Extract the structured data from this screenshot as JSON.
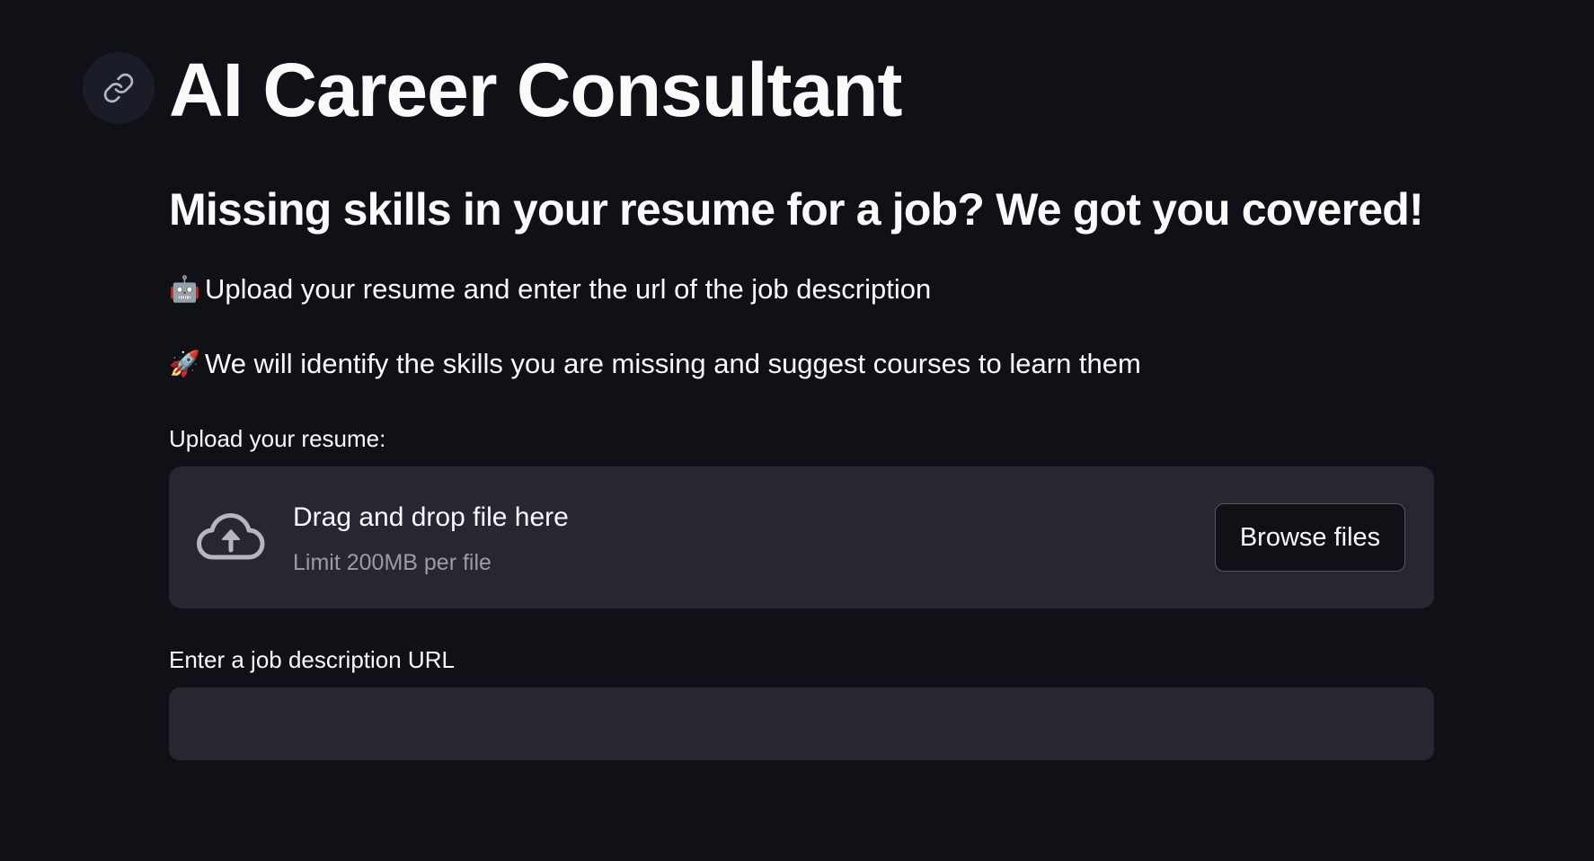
{
  "header": {
    "anchor_icon": "link-icon",
    "title": "AI Career Consultant"
  },
  "intro": {
    "subheading": "Missing skills in your resume for a job? We got you covered!",
    "lines": [
      {
        "icon": "robot-emoji",
        "emoji": "🤖",
        "text": "Upload your resume and enter the url of the job description"
      },
      {
        "icon": "rocket-emoji",
        "emoji": "🚀",
        "text": "We will identify the skills you are missing and suggest courses to learn them"
      }
    ]
  },
  "resume_upload": {
    "label": "Upload your resume:",
    "icon": "cloud-upload-icon",
    "drop_title": "Drag and drop file here",
    "limit_text": "Limit 200MB per file",
    "browse_label": "Browse files"
  },
  "job_url": {
    "label": "Enter a job description URL",
    "value": "",
    "placeholder": ""
  },
  "colors": {
    "background": "#0f1116",
    "panel": "#262730",
    "text": "#fafafa",
    "muted_text": "#9a9ca6",
    "icon_gray": "#b5b7c0"
  }
}
